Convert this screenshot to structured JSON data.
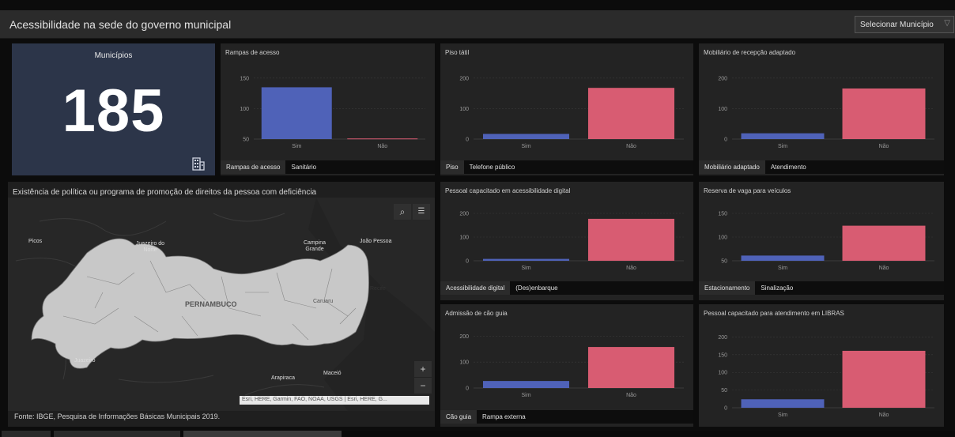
{
  "header": {
    "title": "Acessibilidade na sede do governo municipal",
    "selector_label": "Selecionar Município"
  },
  "kpi": {
    "label": "Municípios",
    "value": "185"
  },
  "colors": {
    "sim": "#4f62b8",
    "nao": "#d85c72"
  },
  "charts": [
    {
      "id": "rampas",
      "title": "Rampas de acesso",
      "tabs": [
        "Rampas de acesso",
        "Sanitário"
      ],
      "chart_data": {
        "type": "bar",
        "categories": [
          "Sim",
          "Não"
        ],
        "values": [
          135,
          51
        ],
        "yticks": [
          50,
          100,
          150
        ],
        "ylim": [
          50,
          155
        ]
      }
    },
    {
      "id": "piso",
      "title": "Piso tátil",
      "tabs": [
        "Piso",
        "Telefone público"
      ],
      "chart_data": {
        "type": "bar",
        "categories": [
          "Sim",
          "Não"
        ],
        "values": [
          17,
          168
        ],
        "yticks": [
          0,
          100,
          200
        ],
        "ylim": [
          0,
          210
        ]
      }
    },
    {
      "id": "mobiliario",
      "title": "Mobiliário de recepção adaptado",
      "tabs": [
        "Mobiliário adaptado",
        "Atendimento"
      ],
      "chart_data": {
        "type": "bar",
        "categories": [
          "Sim",
          "Não"
        ],
        "values": [
          19,
          166
        ],
        "yticks": [
          0,
          100,
          200
        ],
        "ylim": [
          0,
          210
        ]
      }
    },
    {
      "id": "digital",
      "title": "Pessoal capacitado em acessibilidade digital",
      "tabs": [
        "Acessibilidade digital",
        "(Des)enbarque"
      ],
      "chart_data": {
        "type": "bar",
        "categories": [
          "Sim",
          "Não"
        ],
        "values": [
          8,
          177
        ],
        "yticks": [
          0,
          100,
          200
        ],
        "ylim": [
          0,
          210
        ]
      }
    },
    {
      "id": "reserva",
      "title": "Reserva de vaga para veículos",
      "tabs": [
        "Estacionamento",
        "Sinalização"
      ],
      "chart_data": {
        "type": "bar",
        "categories": [
          "Sim",
          "Não"
        ],
        "values": [
          61,
          124
        ],
        "yticks": [
          50,
          100,
          150
        ],
        "ylim": [
          50,
          155
        ]
      }
    },
    {
      "id": "cao",
      "title": "Admissão de cão guia",
      "tabs": [
        "Cão guia",
        "Rampa externa"
      ],
      "chart_data": {
        "type": "bar",
        "categories": [
          "Sim",
          "Não"
        ],
        "values": [
          27,
          158
        ],
        "yticks": [
          0,
          100,
          200
        ],
        "ylim": [
          0,
          210
        ]
      }
    },
    {
      "id": "libras",
      "title": "Pessoal capacitado para atendimento em LIBRAS",
      "tabs": [],
      "chart_data": {
        "type": "bar",
        "categories": [
          "Sim",
          "Não"
        ],
        "values": [
          24,
          161
        ],
        "yticks": [
          0,
          50,
          100,
          150,
          200
        ],
        "ylim": [
          0,
          210
        ]
      }
    }
  ],
  "map": {
    "title": "Existência de política ou programa de promoção de direitos da pessoa com deficiência",
    "labels": [
      "Picos",
      "Juazeiro do Norte",
      "Campina Grande",
      "João Pessoa",
      "PERNAMBUCO",
      "Caruaru",
      "Recife",
      "Juazeiro",
      "Arapiraca",
      "Maceió"
    ],
    "attribution": "Esri, HERE, Garmin, FAO, NOAA, USGS | Esri, HERE, G...",
    "source": "Fonte: IBGE, Pesquisa de Informações Básicas Municipais 2019.",
    "zoom_in": "+",
    "zoom_out": "−"
  }
}
